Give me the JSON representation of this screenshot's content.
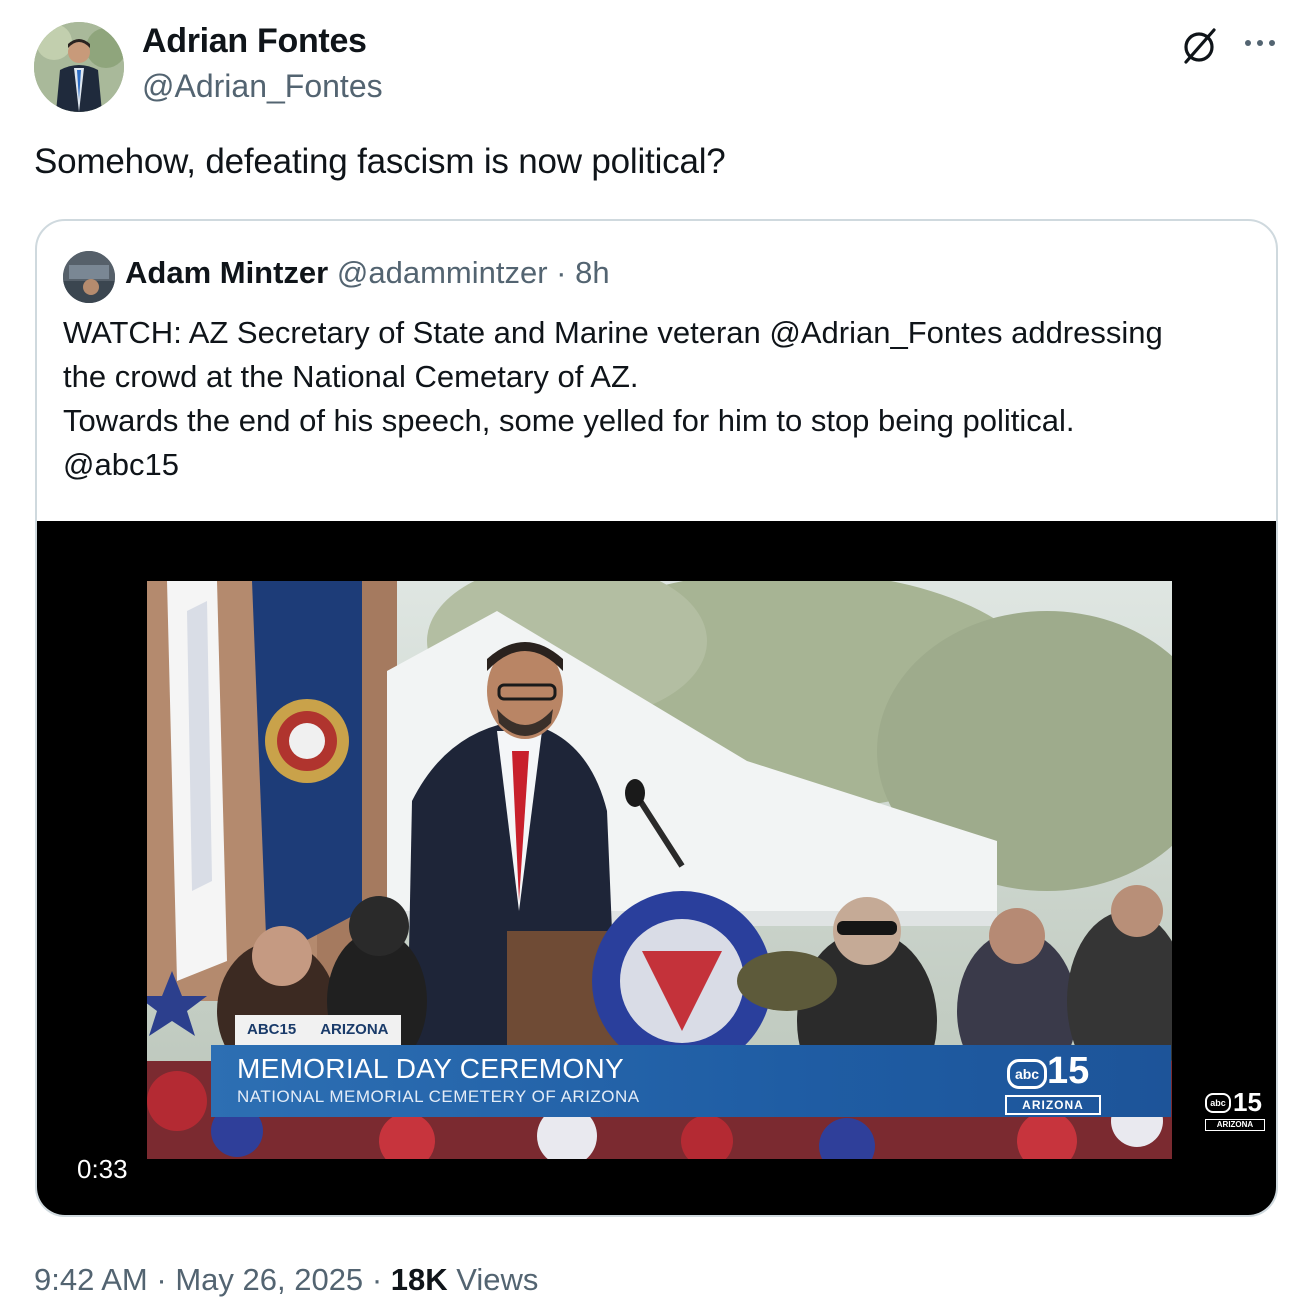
{
  "author": {
    "name": "Adrian Fontes",
    "handle": "@Adrian_Fontes"
  },
  "icons": {
    "grok": "grok-icon",
    "more": "more-icon"
  },
  "tweet": {
    "text": "Somehow, defeating fascism is now political?"
  },
  "quoted": {
    "name": "Adam Mintzer",
    "handle": "@adammintzer",
    "separator": "·",
    "time": "8h",
    "lines": [
      "WATCH: AZ Secretary of State and Marine veteran @Adrian_Fontes addressing",
      "the crowd at the National Cemetary of AZ.",
      "Towards the end of his speech, some yelled for him to stop being political.",
      "@abc15"
    ]
  },
  "video": {
    "duration": "0:33",
    "tags": [
      "ABC15",
      "ARIZONA"
    ],
    "title": "MEMORIAL DAY CEREMONY",
    "subtitle": "NATIONAL MEMORIAL CEMETERY OF ARIZONA",
    "logo_abc": "abc",
    "logo_number": "15",
    "logo_state": "ARIZONA"
  },
  "footer": {
    "time": "9:42 AM",
    "sep1": "·",
    "date": "May 26, 2025",
    "sep2": "·",
    "views_count": "18K",
    "views_label": "Views"
  }
}
